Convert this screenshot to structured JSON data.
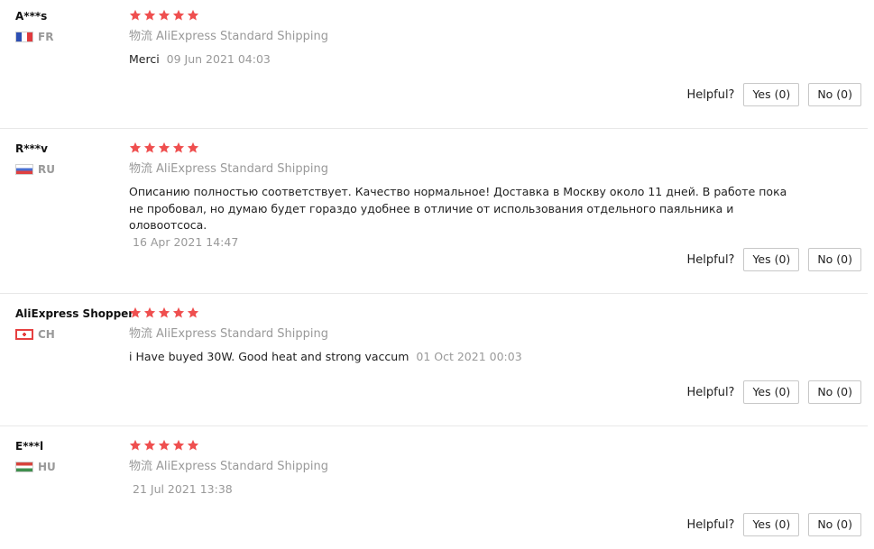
{
  "colors": {
    "star": "#ef4f4f",
    "divider": "#e8e8e8",
    "muted": "#999999"
  },
  "reviews": [
    {
      "user": "A***s",
      "country": "FR",
      "flag": "france-flag",
      "rating": 5,
      "logistics_label": "物流",
      "shipping_method": "AliExpress Standard Shipping",
      "text": "Merci",
      "date": "09 Jun 2021 04:03",
      "helpful_label": "Helpful?",
      "yes_label": "Yes (0)",
      "no_label": "No (0)"
    },
    {
      "user": "R***v",
      "country": "RU",
      "flag": "russia-flag",
      "rating": 5,
      "logistics_label": "物流",
      "shipping_method": "AliExpress Standard Shipping",
      "text": "Описанию полностью соответствует. Качество нормальное! Доставка в Москву около 11 дней. В работе пока не пробовал, но думаю будет гораздо удобнее в отличие от использования отдельного паяльника и оловоотсоса.",
      "date": "16 Apr 2021 14:47",
      "helpful_label": "Helpful?",
      "yes_label": "Yes (0)",
      "no_label": "No (0)"
    },
    {
      "user": "AliExpress Shopper",
      "country": "CH",
      "flag": "switzerland-flag",
      "rating": 5,
      "logistics_label": "物流",
      "shipping_method": "AliExpress Standard Shipping",
      "text": "i Have buyed 30W. Good heat and strong vaccum",
      "date": "01 Oct 2021 00:03",
      "helpful_label": "Helpful?",
      "yes_label": "Yes (0)",
      "no_label": "No (0)"
    },
    {
      "user": "E***l",
      "country": "HU",
      "flag": "hungary-flag",
      "rating": 5,
      "logistics_label": "物流",
      "shipping_method": "AliExpress Standard Shipping",
      "text": "",
      "date": "21 Jul 2021 13:38",
      "helpful_label": "Helpful?",
      "yes_label": "Yes (0)",
      "no_label": "No (0)"
    }
  ]
}
